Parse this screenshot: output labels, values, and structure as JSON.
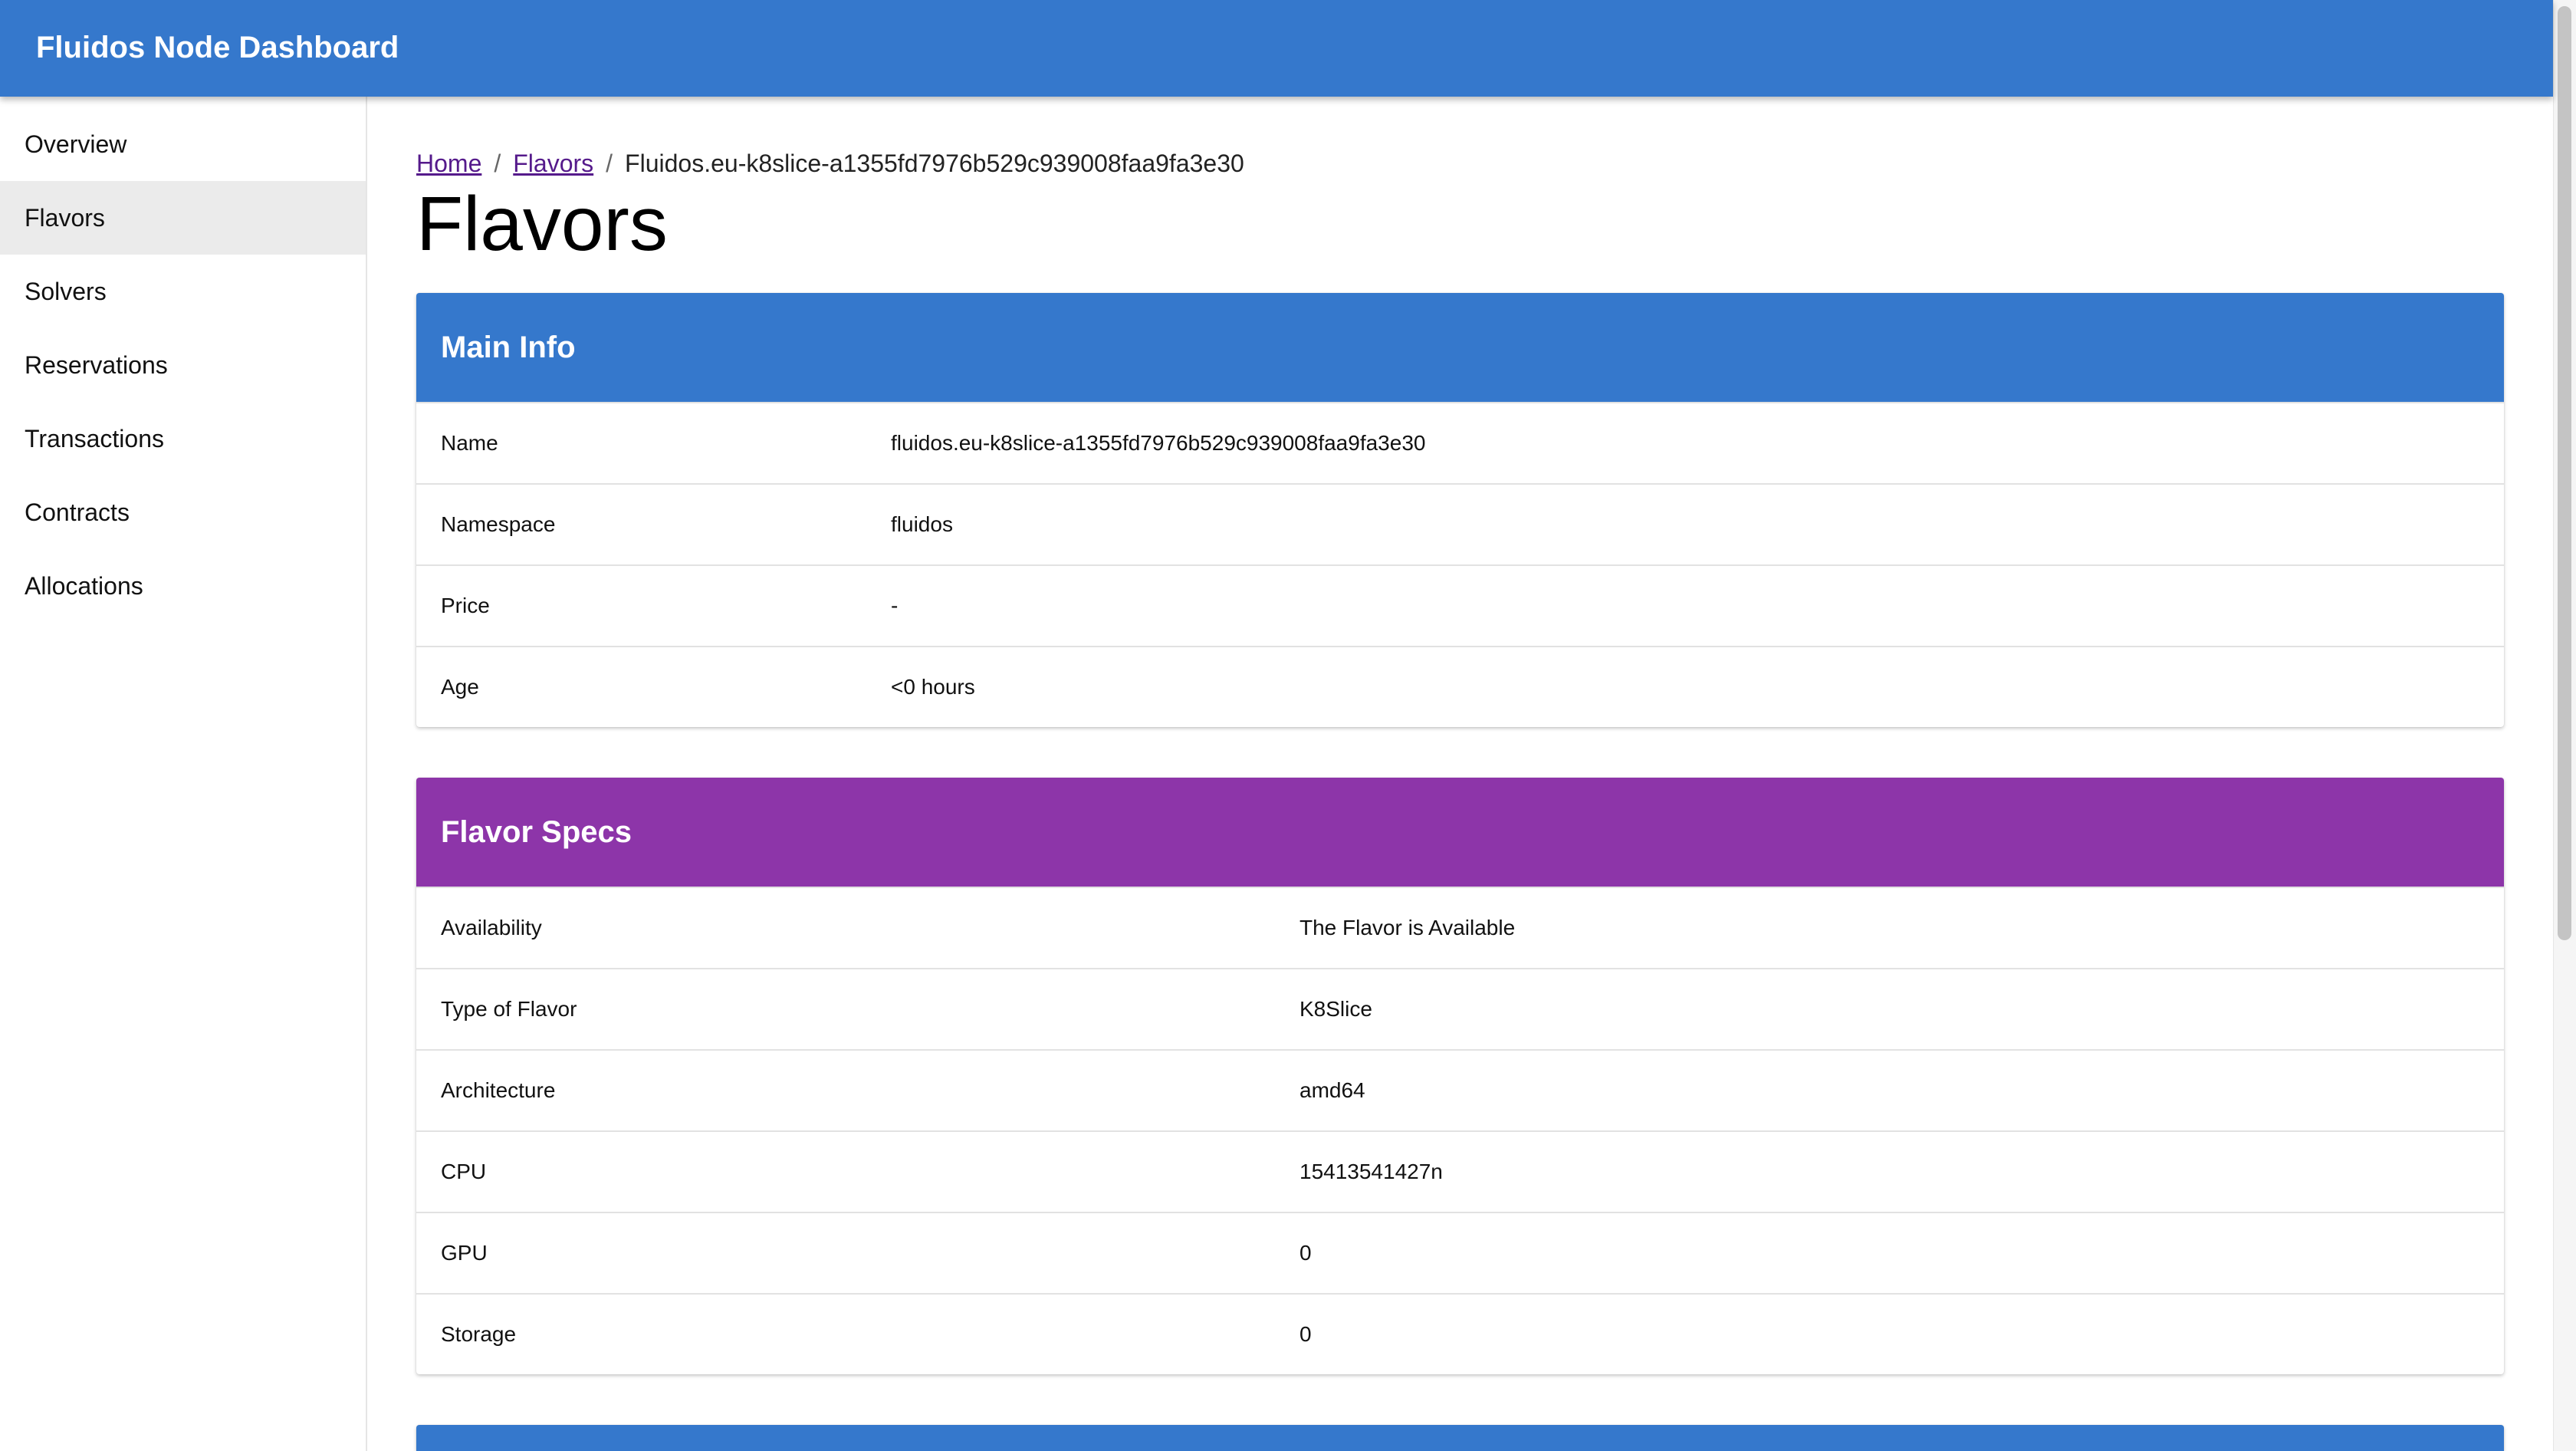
{
  "app": {
    "title": "Fluidos Node Dashboard"
  },
  "sidebar": {
    "items": [
      {
        "label": "Overview"
      },
      {
        "label": "Flavors",
        "active": true
      },
      {
        "label": "Solvers"
      },
      {
        "label": "Reservations"
      },
      {
        "label": "Transactions"
      },
      {
        "label": "Contracts"
      },
      {
        "label": "Allocations"
      }
    ]
  },
  "breadcrumb": {
    "home": "Home",
    "separator": "/",
    "flavors": "Flavors",
    "current": "Fluidos.eu-k8slice-a1355fd7976b529c939008faa9fa3e30"
  },
  "page": {
    "title": "Flavors"
  },
  "main_info": {
    "title": "Main Info",
    "header_color": "#3578cc",
    "rows": [
      {
        "key": "Name",
        "value": "fluidos.eu-k8slice-a1355fd7976b529c939008faa9fa3e30"
      },
      {
        "key": "Namespace",
        "value": "fluidos"
      },
      {
        "key": "Price",
        "value": "-"
      },
      {
        "key": "Age",
        "value": "<0 hours"
      }
    ]
  },
  "flavor_specs": {
    "title": "Flavor Specs",
    "header_color": "#8d35a9",
    "rows": [
      {
        "key": "Availability",
        "value": "The Flavor is Available"
      },
      {
        "key": "Type of Flavor",
        "value": "K8Slice"
      },
      {
        "key": "Architecture",
        "value": "amd64"
      },
      {
        "key": "CPU",
        "value": "15413541427n"
      },
      {
        "key": "GPU",
        "value": "0"
      },
      {
        "key": "Storage",
        "value": "0"
      }
    ]
  },
  "next_section": {
    "header_color": "#3578cc"
  },
  "colors": {
    "appbar": "#3578cc",
    "sidebar_active": "#ebebeb",
    "link_visited": "#551a8b"
  }
}
